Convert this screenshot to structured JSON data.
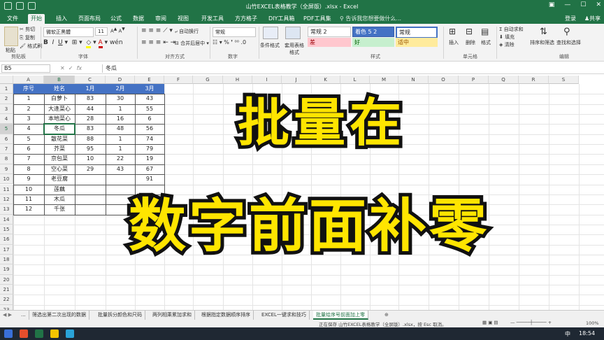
{
  "window": {
    "title": "山竹EXCEL表格教学（全屏版）.xlsx - Excel"
  },
  "ribbon_tabs": [
    "文件",
    "开始",
    "插入",
    "页面布局",
    "公式",
    "数据",
    "审阅",
    "视图",
    "开发工具",
    "方方格子",
    "DIY工具箱",
    "PDF工具集"
  ],
  "tell_me": "告诉我您想要做什么...",
  "account": {
    "login": "登录",
    "share": "共享"
  },
  "clipboard": {
    "cut": "剪切",
    "copy": "复制",
    "painter": "格式刷",
    "paste": "粘贴",
    "group": "剪贴板"
  },
  "font": {
    "name": "微软正黑體",
    "size": "11",
    "group": "字体"
  },
  "alignment": {
    "wrap": "自动换行",
    "merge": "合并后居中",
    "group": "对齐方式"
  },
  "number": {
    "format": "常规",
    "group": "数字"
  },
  "styles": {
    "cond": "条件格式",
    "table": "套用表格格式",
    "normal2": "常规 2",
    "accent": "着色 5 2",
    "normal": "常规",
    "bad": "差",
    "good": "好",
    "neutral": "适中",
    "group": "样式"
  },
  "cells": {
    "insert": "插入",
    "delete": "删除",
    "format": "格式",
    "group": "单元格"
  },
  "editing": {
    "autosum": "自动求和",
    "fill": "填充",
    "clear": "清除",
    "sort": "排序和筛选",
    "find": "查找和选择",
    "group": "编辑"
  },
  "formula_bar": {
    "name_box": "B5",
    "fx": "fx",
    "value": "冬瓜"
  },
  "columns": [
    "A",
    "B",
    "C",
    "D",
    "E",
    "F",
    "G",
    "H",
    "I",
    "J",
    "K",
    "L",
    "M",
    "N",
    "O",
    "P",
    "Q",
    "R",
    "S"
  ],
  "rows": [
    "1",
    "2",
    "3",
    "4",
    "5",
    "6",
    "7",
    "8",
    "9",
    "10",
    "11",
    "12",
    "13",
    "14",
    "15",
    "16",
    "17",
    "18",
    "19",
    "20",
    "21",
    "22",
    "23",
    "24"
  ],
  "table": {
    "headers": [
      "序号",
      "姓名",
      "1月",
      "2月",
      "3月"
    ],
    "rows": [
      [
        "1",
        "白萝卜",
        "83",
        "30",
        "43"
      ],
      [
        "2",
        "大逢菜心",
        "44",
        "1",
        "55"
      ],
      [
        "3",
        "本地菜心",
        "28",
        "16",
        "6"
      ],
      [
        "4",
        "冬瓜",
        "83",
        "48",
        "56"
      ],
      [
        "5",
        "散花菜",
        "88",
        "1",
        "74"
      ],
      [
        "6",
        "芥菜",
        "95",
        "1",
        "79"
      ],
      [
        "7",
        "京包菜",
        "10",
        "22",
        "19"
      ],
      [
        "8",
        "空心菜",
        "29",
        "43",
        "67"
      ],
      [
        "9",
        "老豆腐",
        "",
        "",
        "91"
      ],
      [
        "10",
        "莲藕",
        "",
        "",
        ""
      ],
      [
        "11",
        "木瓜",
        "",
        "",
        ""
      ],
      [
        "12",
        "千张",
        "",
        "",
        ""
      ]
    ]
  },
  "overlay": {
    "line1": "批量在",
    "line2": "数字前面补零"
  },
  "sheets": [
    "...",
    "筛选出第二次出现的数据",
    "批量拆分颜色和尺码",
    "两列相乘累加求和",
    "根据指定数据顺序排序",
    "EXCEL一键求和技巧",
    "批量给序号前面加上零"
  ],
  "status": {
    "text": "正在保存 山竹EXCEL表格教学（全屏版）.xlsx，按 Esc 取消。",
    "zoom": "100%"
  },
  "taskbar": {
    "time": "18:54",
    "ime": "中"
  },
  "colors": {
    "excel_green": "#217346",
    "header_blue": "#4472c4",
    "overlay_yellow": "#ffe500"
  }
}
